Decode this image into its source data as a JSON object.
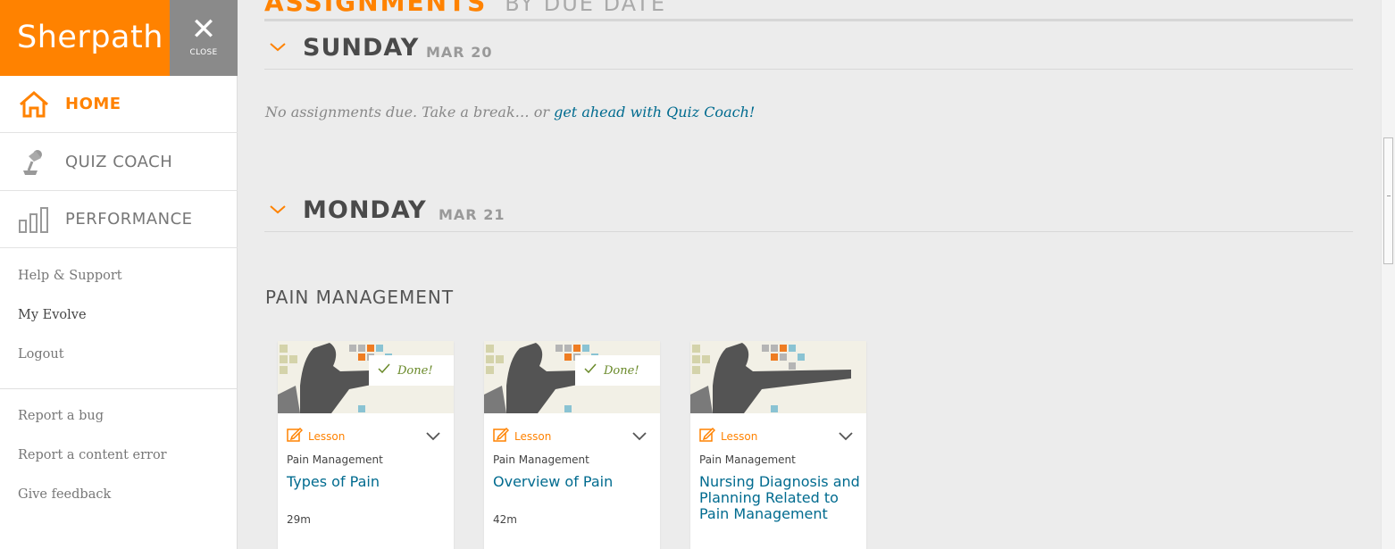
{
  "brand": {
    "name": "Sherpath",
    "color": "#ff8200"
  },
  "close": {
    "icon": "close-icon",
    "label": "CLOSE"
  },
  "nav": [
    {
      "label": "HOME",
      "icon": "home-icon",
      "active": true
    },
    {
      "label": "QUIZ COACH",
      "icon": "lamp-icon",
      "active": false
    },
    {
      "label": "PERFORMANCE",
      "icon": "bar-chart-icon",
      "active": false
    }
  ],
  "links": [
    "Help & Support",
    "My Evolve",
    "Logout"
  ],
  "footer_links": [
    "Report a bug",
    "Report a content error",
    "Give feedback"
  ],
  "header": {
    "title": "ASSIGNMENTS",
    "subtitle": "BY DUE DATE"
  },
  "days": [
    {
      "name": "SUNDAY",
      "date": "MAR 20"
    },
    {
      "name": "MONDAY",
      "date": "MAR 21"
    }
  ],
  "no_assignments": {
    "text": "No assignments due. Take a break… or ",
    "link": "get ahead with Quiz Coach!"
  },
  "section_title": "PAIN MANAGEMENT",
  "cards": [
    {
      "done_label": "Done!",
      "type": "Lesson",
      "course": "Pain Management",
      "title": "Types of Pain",
      "duration": "29m"
    },
    {
      "done_label": "Done!",
      "type": "Lesson",
      "course": "Pain Management",
      "title": "Overview of Pain",
      "duration": "42m"
    },
    {
      "done_label": "",
      "type": "Lesson",
      "course": "Pain Management",
      "title": "Nursing Diagnosis and Planning Related to Pain Management",
      "duration": ""
    }
  ],
  "colors": {
    "accent": "#ff8200",
    "link": "#006b8f",
    "done": "#6a8a2a"
  }
}
